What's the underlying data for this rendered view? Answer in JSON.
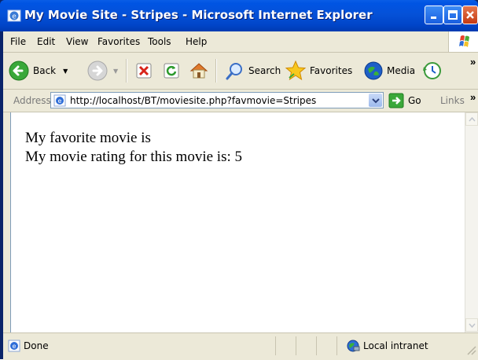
{
  "window": {
    "title": "My Movie Site - Stripes - Microsoft Internet Explorer"
  },
  "menu": {
    "items": [
      "File",
      "Edit",
      "View",
      "Favorites",
      "Tools",
      "Help"
    ]
  },
  "toolbar": {
    "back_label": "Back",
    "search_label": "Search",
    "favorites_label": "Favorites",
    "media_label": "Media"
  },
  "address": {
    "label": "Address",
    "url": "http://localhost/BT/moviesite.php?favmovie=Stripes",
    "go_label": "Go",
    "links_label": "Links"
  },
  "content": {
    "line1": "My favorite movie is",
    "line2": "My movie rating for this movie is: 5"
  },
  "status": {
    "text": "Done",
    "zone": "Local intranet"
  },
  "colors": {
    "titlebar": "#0054e3",
    "chrome": "#ece9d8",
    "close_button": "#c43a12"
  }
}
